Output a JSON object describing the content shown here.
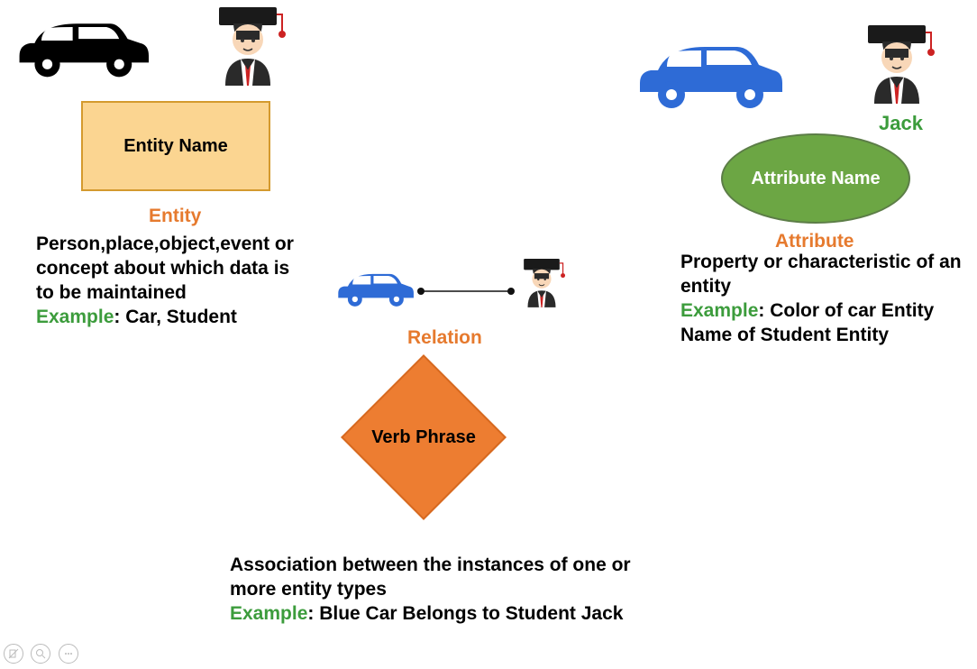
{
  "entity": {
    "box_label": "Entity Name",
    "title": "Entity",
    "description": "Person,place,object,event or concept about which data is to be maintained",
    "example_prefix": "Example",
    "example_text": ": Car, Student"
  },
  "relation": {
    "title": "Relation",
    "diamond_label": "Verb Phrase",
    "description": "Association between the instances of one or more entity types",
    "example_prefix": "Example",
    "example_text": ": Blue Car Belongs to Student Jack"
  },
  "attribute": {
    "ellipse_label": "Attribute Name",
    "title": "Attribute",
    "description": "Property or characteristic of an entity",
    "example_prefix": "Example",
    "example_text": ": Color of car Entity Name of Student Entity",
    "jack_label": "Jack"
  },
  "icons": {
    "car_black": "car-icon",
    "car_blue": "car-icon",
    "student": "graduate-icon"
  }
}
